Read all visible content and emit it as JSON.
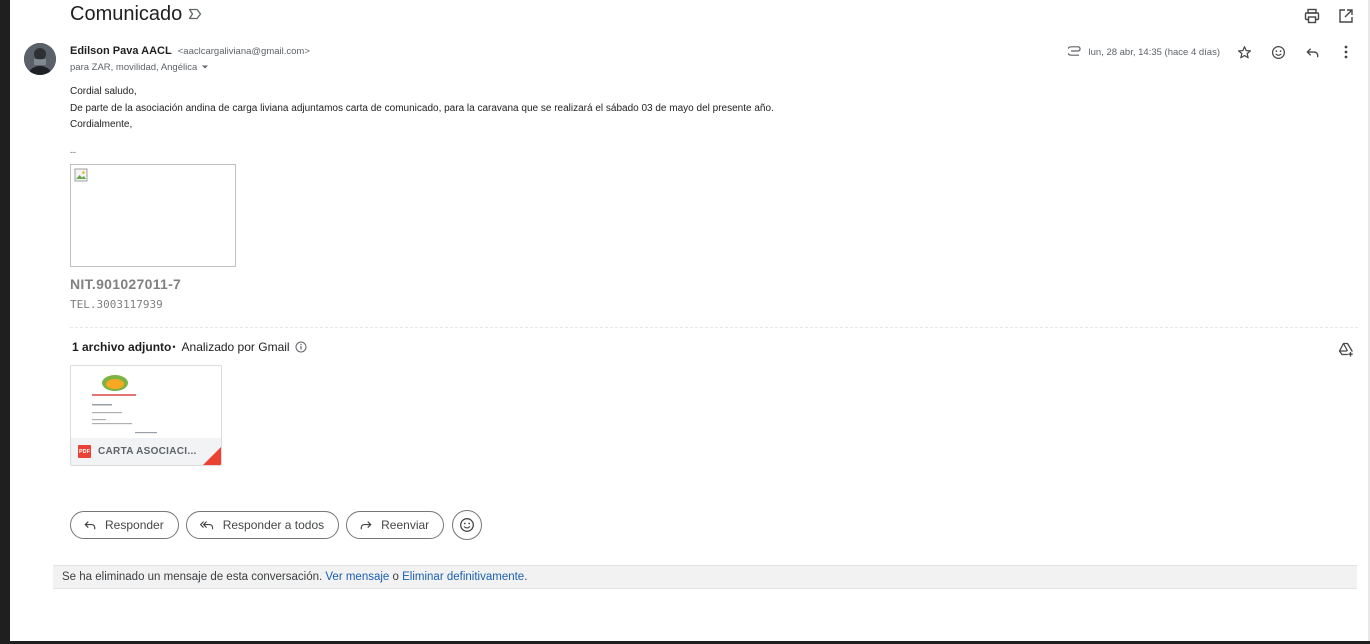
{
  "email": {
    "subject": "Comunicado",
    "sender_name": "Edilson Pava AACL",
    "sender_email": "<aaclcargaliviana@gmail.com>",
    "recipients": "para ZAR, movilidad, Angélica",
    "date": "lun, 28 abr, 14:35 (hace 4 días)",
    "body": {
      "greeting": "Cordial saludo,",
      "line1": "De parte de la asociación andina de carga liviana adjuntamos carta de comunicado, para la caravana que se realizará el sábado 03 de mayo del presente año.",
      "closing": "Cordialmente,",
      "separator": "--"
    },
    "signature": {
      "nit": "NIT.901027011-7",
      "tel": "TEL.3003117939"
    }
  },
  "attachments": {
    "count_label": "1 archivo adjunto",
    "bullet": "•",
    "analyzed_label": "Analizado por Gmail",
    "items": [
      {
        "name": "CARTA ASOCIACI...",
        "type_badge": "PDF"
      }
    ]
  },
  "reply_actions": {
    "reply": "Responder",
    "reply_all": "Responder a todos",
    "forward": "Reenviar"
  },
  "deleted_notice": {
    "text_before": "Se ha eliminado un mensaje de esta conversación. ",
    "view_link": "Ver mensaje",
    "or": " o ",
    "delete_link": "Eliminar definitivamente",
    "period": "."
  },
  "icons": {
    "label_icon": "label-outline-icon",
    "print": "print-icon",
    "open_new_window": "open-in-new-icon",
    "attachment_clip": "paperclip-icon",
    "star": "star-icon",
    "emoji": "emoji-icon",
    "reply": "reply-icon",
    "more": "more-vert-icon",
    "info": "info-icon",
    "add_to_drive": "add-to-drive-icon"
  },
  "colors": {
    "link": "#1a5fb4",
    "pdf_red": "#ea4335",
    "muted_text": "#5f6368",
    "signature_gray": "#808080"
  }
}
